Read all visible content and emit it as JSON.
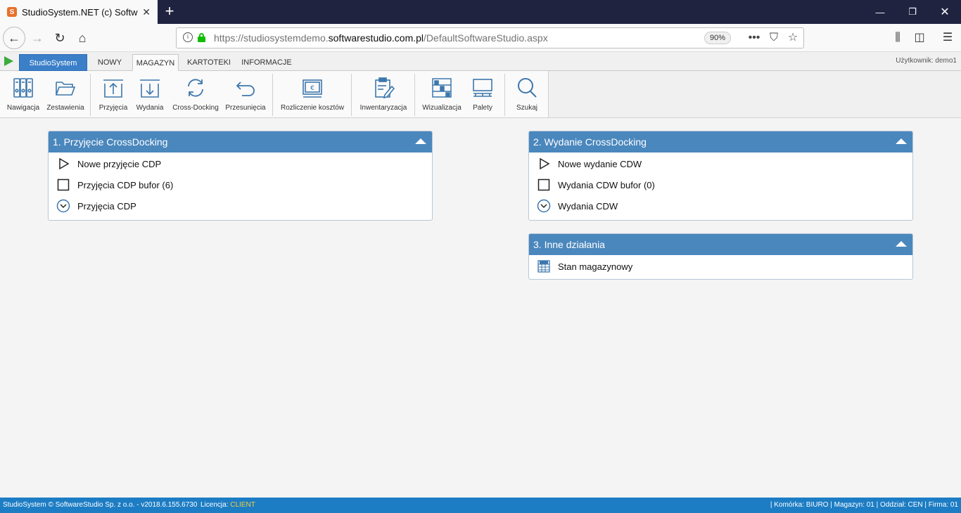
{
  "browser": {
    "tab_title": "StudioSystem.NET (c) SoftwareStudio",
    "url_prefix": "https://studiosystemdemo.",
    "url_domain": "softwarestudio.com.pl",
    "url_path": "/DefaultSoftwareStudio.aspx",
    "zoom": "90%"
  },
  "app": {
    "brand_tab": "StudioSystem",
    "tabs": [
      "NOWY",
      "MAGAZYN",
      "KARTOTEKI",
      "INFORMACJE"
    ],
    "active_tab": "MAGAZYN",
    "user_label": "Użytkownik: demo1"
  },
  "ribbon": {
    "buttons": [
      {
        "label": "Nawigacja",
        "icon": "binders-icon"
      },
      {
        "label": "Zestawienia",
        "icon": "folder-open-icon"
      },
      {
        "label": "Przyjęcia",
        "icon": "arrow-up-box-icon"
      },
      {
        "label": "Wydania",
        "icon": "arrow-down-box-icon"
      },
      {
        "label": "Cross-Docking",
        "icon": "refresh-cycle-icon"
      },
      {
        "label": "Przesunięcia",
        "icon": "undo-arrow-icon"
      },
      {
        "label": "Rozliczenie kosztów",
        "icon": "invoice-euro-icon"
      },
      {
        "label": "Inwentaryzacja",
        "icon": "clipboard-pen-icon"
      },
      {
        "label": "Wizualizacja",
        "icon": "warehouse-racks-icon"
      },
      {
        "label": "Palety",
        "icon": "pallet-icon"
      },
      {
        "label": "Szukaj",
        "icon": "magnifier-icon"
      }
    ]
  },
  "panels": {
    "p1": {
      "title": "1. Przyjęcie CrossDocking",
      "items": [
        "Nowe przyjęcie CDP",
        "Przyjęcia CDP bufor (6)",
        "Przyjęcia CDP"
      ]
    },
    "p2": {
      "title": "2. Wydanie CrossDocking",
      "items": [
        "Nowe wydanie CDW",
        "Wydania CDW bufor (0)",
        "Wydania CDW"
      ]
    },
    "p3": {
      "title": "3. Inne działania",
      "items": [
        "Stan magazynowy"
      ]
    }
  },
  "status": {
    "left": "StudioSystem © SoftwareStudio Sp. z o.o. - v2018.6.155.6730",
    "license_label": "Licencja:",
    "license_value": "CLIENT",
    "right": "| Komórka: BIURO | Magazyn: 01 | Oddział: CEN | Firma: 01"
  },
  "colors": {
    "panel_header": "#4a87bd",
    "brand_tab": "#3b7fc9",
    "status_bar": "#1d7dc4",
    "icon": "#3d77ad"
  }
}
